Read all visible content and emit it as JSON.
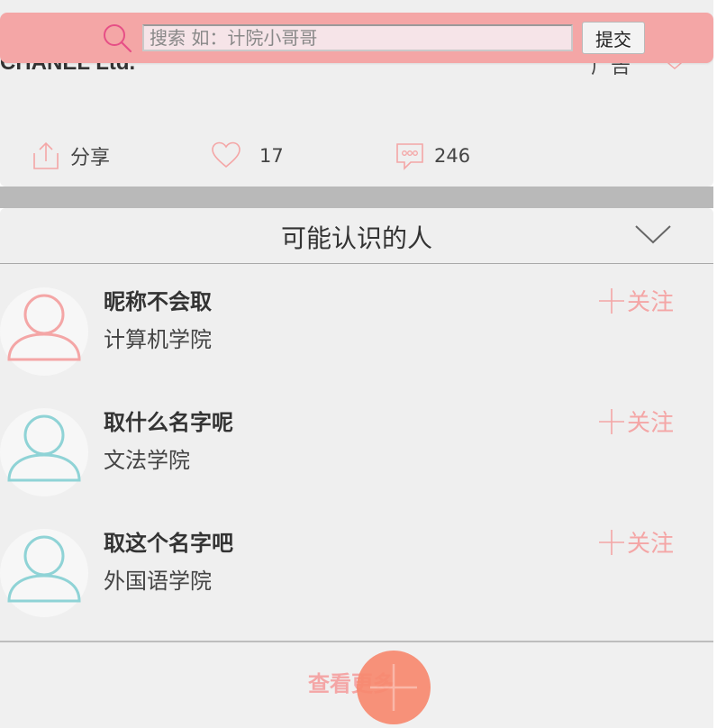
{
  "search": {
    "placeholder": "搜索 如：计院小哥哥",
    "submit_label": "提交"
  },
  "post": {
    "company": "CHANEL Ltd.",
    "ad_label": "广告",
    "share_label": "分享",
    "likes": "17",
    "comments": "246"
  },
  "people": {
    "title": "可能认识的人",
    "items": [
      {
        "name": "昵称不会取",
        "school": "计算机学院",
        "follow_label": "关注",
        "avatar_color": "#f4a6a6"
      },
      {
        "name": "取什么名字呢",
        "school": "文法学院",
        "follow_label": "关注",
        "avatar_color": "#8fd3d6"
      },
      {
        "name": "取这个名字吧",
        "school": "外国语学院",
        "follow_label": "关注",
        "avatar_color": "#8fd3d6"
      }
    ],
    "more_label": "查看更多"
  },
  "colors": {
    "accent_pink": "#f4a6a6",
    "fab_orange": "#f8896f",
    "teal": "#8fd3d6"
  }
}
